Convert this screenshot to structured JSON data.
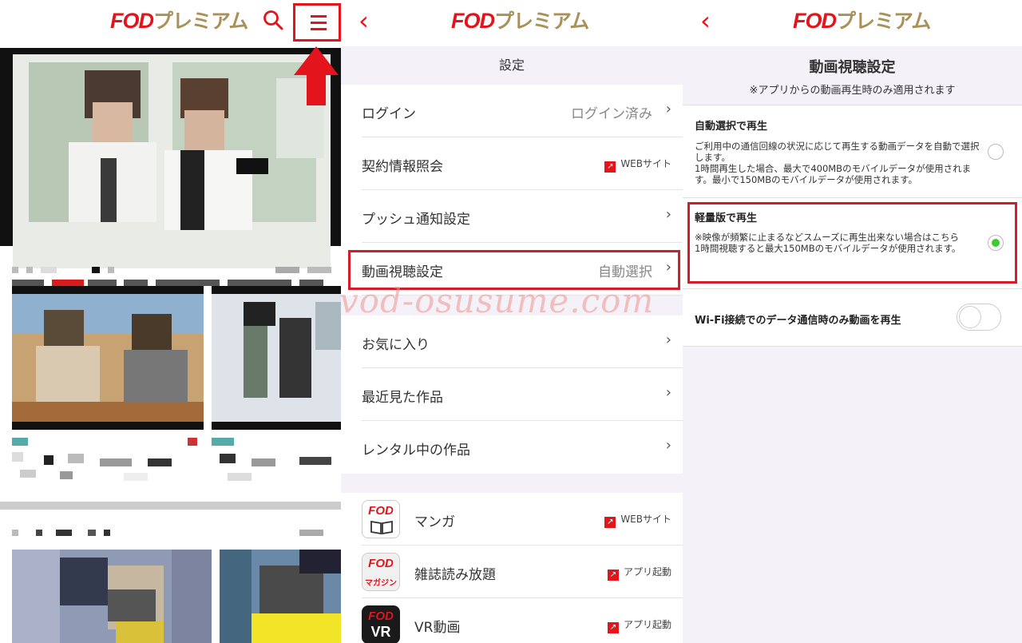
{
  "brand": {
    "logo_main": "FOD",
    "logo_sub": "プレミアム",
    "red": "#e3141c",
    "gold": "#a99158",
    "highlight": "#d21e2b"
  },
  "panel1": {
    "icons": [
      "search-icon",
      "hamburger-menu-icon",
      "red-up-arrow"
    ]
  },
  "panel2": {
    "section_title": "設定",
    "items": [
      {
        "label": "ログイン",
        "value": "ログイン済み"
      },
      {
        "label": "契約情報照会",
        "ext": "WEBサイト"
      },
      {
        "label": "プッシュ通知設定"
      },
      {
        "label": "動画視聴設定",
        "value": "自動選択"
      }
    ],
    "items2": [
      {
        "label": "お気に入り"
      },
      {
        "label": "最近見た作品"
      },
      {
        "label": "レンタル中の作品"
      }
    ],
    "apps": [
      {
        "icon_text": "FOD",
        "label": "マンガ",
        "ext": "WEBサイト"
      },
      {
        "icon_text": "FOD",
        "icon_sub": "マガジン",
        "label": "雑誌読み放題",
        "ext": "アプリ起動"
      },
      {
        "icon_text": "FOD",
        "icon_sub": "VR",
        "label": "VR動画",
        "ext": "アプリ起動"
      }
    ],
    "watermark": "vod-osusume.com"
  },
  "panel3": {
    "title": "動画視聴設定",
    "subtitle": "※アプリからの動画再生時のみ適用されます",
    "options": [
      {
        "title": "自動選択で再生",
        "lines": [
          "ご利用中の通信回線の状況に応じて再生する動画データを自動で選択します。",
          "1時間再生した場合、最大で400MBのモバイルデータが使用されます。最小で150MBのモバイルデータが使用されます。"
        ],
        "selected": false
      },
      {
        "title": "軽量版で再生",
        "lines": [
          "※映像が頻繁に止まるなどスムーズに再生出来ない場合はこちら",
          "1時間視聴すると最大150MBのモバイルデータが使用されます。"
        ],
        "selected": true
      }
    ],
    "wifi_label": "Wi-Fi接続でのデータ通信時のみ動画を再生",
    "wifi_on": false,
    "radio_color": "#3dcc32"
  }
}
